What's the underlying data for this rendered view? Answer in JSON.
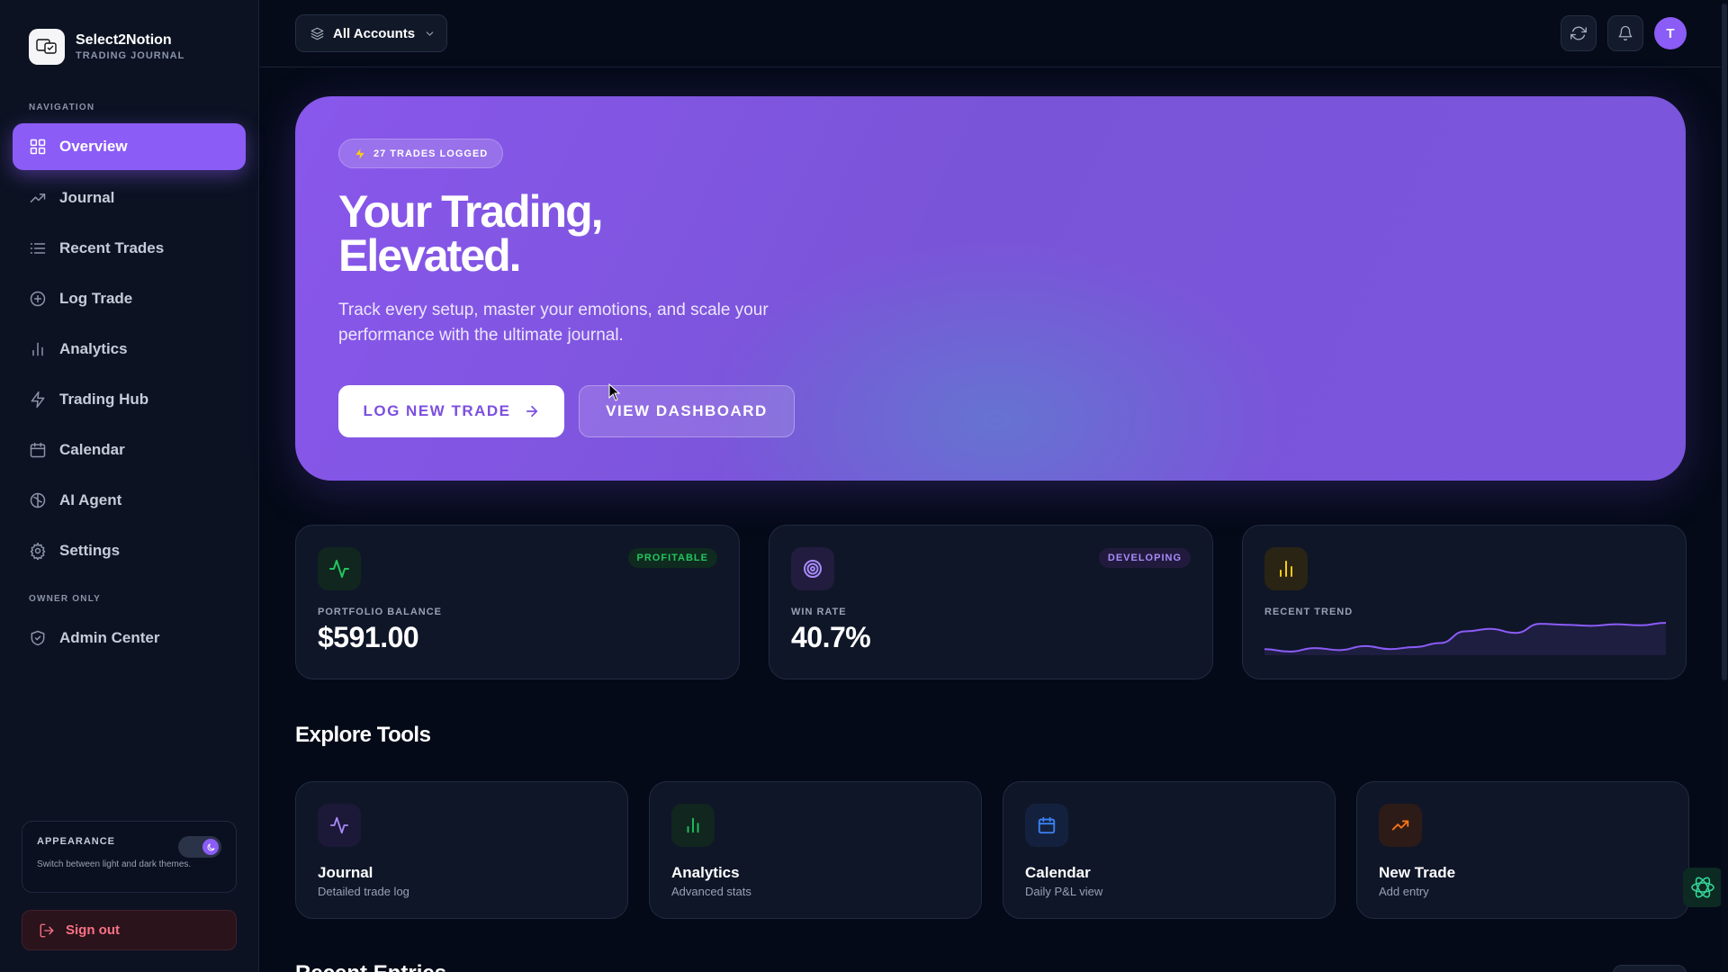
{
  "brand": {
    "name": "Select2Notion",
    "subtitle": "TRADING JOURNAL",
    "logo_text": "Select2Notion"
  },
  "sidebar": {
    "section_navigation": "NAVIGATION",
    "section_owner": "OWNER ONLY",
    "items": [
      {
        "label": "Overview",
        "icon": "grid-icon",
        "active": true
      },
      {
        "label": "Journal",
        "icon": "trending-up-icon"
      },
      {
        "label": "Recent Trades",
        "icon": "list-icon"
      },
      {
        "label": "Log Trade",
        "icon": "plus-circle-icon"
      },
      {
        "label": "Analytics",
        "icon": "bar-chart-icon"
      },
      {
        "label": "Trading Hub",
        "icon": "zap-icon"
      },
      {
        "label": "Calendar",
        "icon": "calendar-icon"
      },
      {
        "label": "AI Agent",
        "icon": "brain-icon"
      },
      {
        "label": "Settings",
        "icon": "gear-icon"
      }
    ],
    "owner_items": [
      {
        "label": "Admin Center",
        "icon": "shield-icon"
      }
    ],
    "appearance": {
      "title": "APPEARANCE",
      "description": "Switch between light and dark themes.",
      "dark_mode": true
    },
    "signout_label": "Sign out"
  },
  "header": {
    "account_select": "All Accounts",
    "avatar_initial": "T"
  },
  "hero": {
    "badge": "27 TRADES LOGGED",
    "title_line1": "Your Trading,",
    "title_line2": "Elevated.",
    "description": "Track every setup, master your emotions, and scale your performance with the ultimate journal.",
    "primary_button": "LOG NEW TRADE",
    "secondary_button": "VIEW DASHBOARD"
  },
  "stats": {
    "portfolio": {
      "label": "PORTFOLIO BALANCE",
      "value": "$591.00",
      "pill": "PROFITABLE"
    },
    "winrate": {
      "label": "WIN RATE",
      "value": "40.7%",
      "pill": "DEVELOPING"
    },
    "trend": {
      "label": "RECENT TREND",
      "values": [
        2,
        1.5,
        2.2,
        1.8,
        2.6,
        2.0,
        2.4,
        3.2,
        5.5,
        6.0,
        5.2,
        7.0,
        6.8,
        6.6,
        6.9,
        6.7,
        7.2
      ]
    }
  },
  "explore": {
    "title": "Explore Tools",
    "tools": [
      {
        "title": "Journal",
        "subtitle": "Detailed trade log",
        "icon": "activity-icon"
      },
      {
        "title": "Analytics",
        "subtitle": "Advanced stats",
        "icon": "bar-chart-icon"
      },
      {
        "title": "Calendar",
        "subtitle": "Daily P&L view",
        "icon": "calendar-icon"
      },
      {
        "title": "New Trade",
        "subtitle": "Add entry",
        "icon": "trending-up-icon"
      }
    ]
  },
  "recent": {
    "title": "Recent Entries"
  },
  "colors": {
    "accent": "#8b5cf6",
    "profit": "#22c55e",
    "loss": "#fb7185",
    "background": "#050a18"
  }
}
